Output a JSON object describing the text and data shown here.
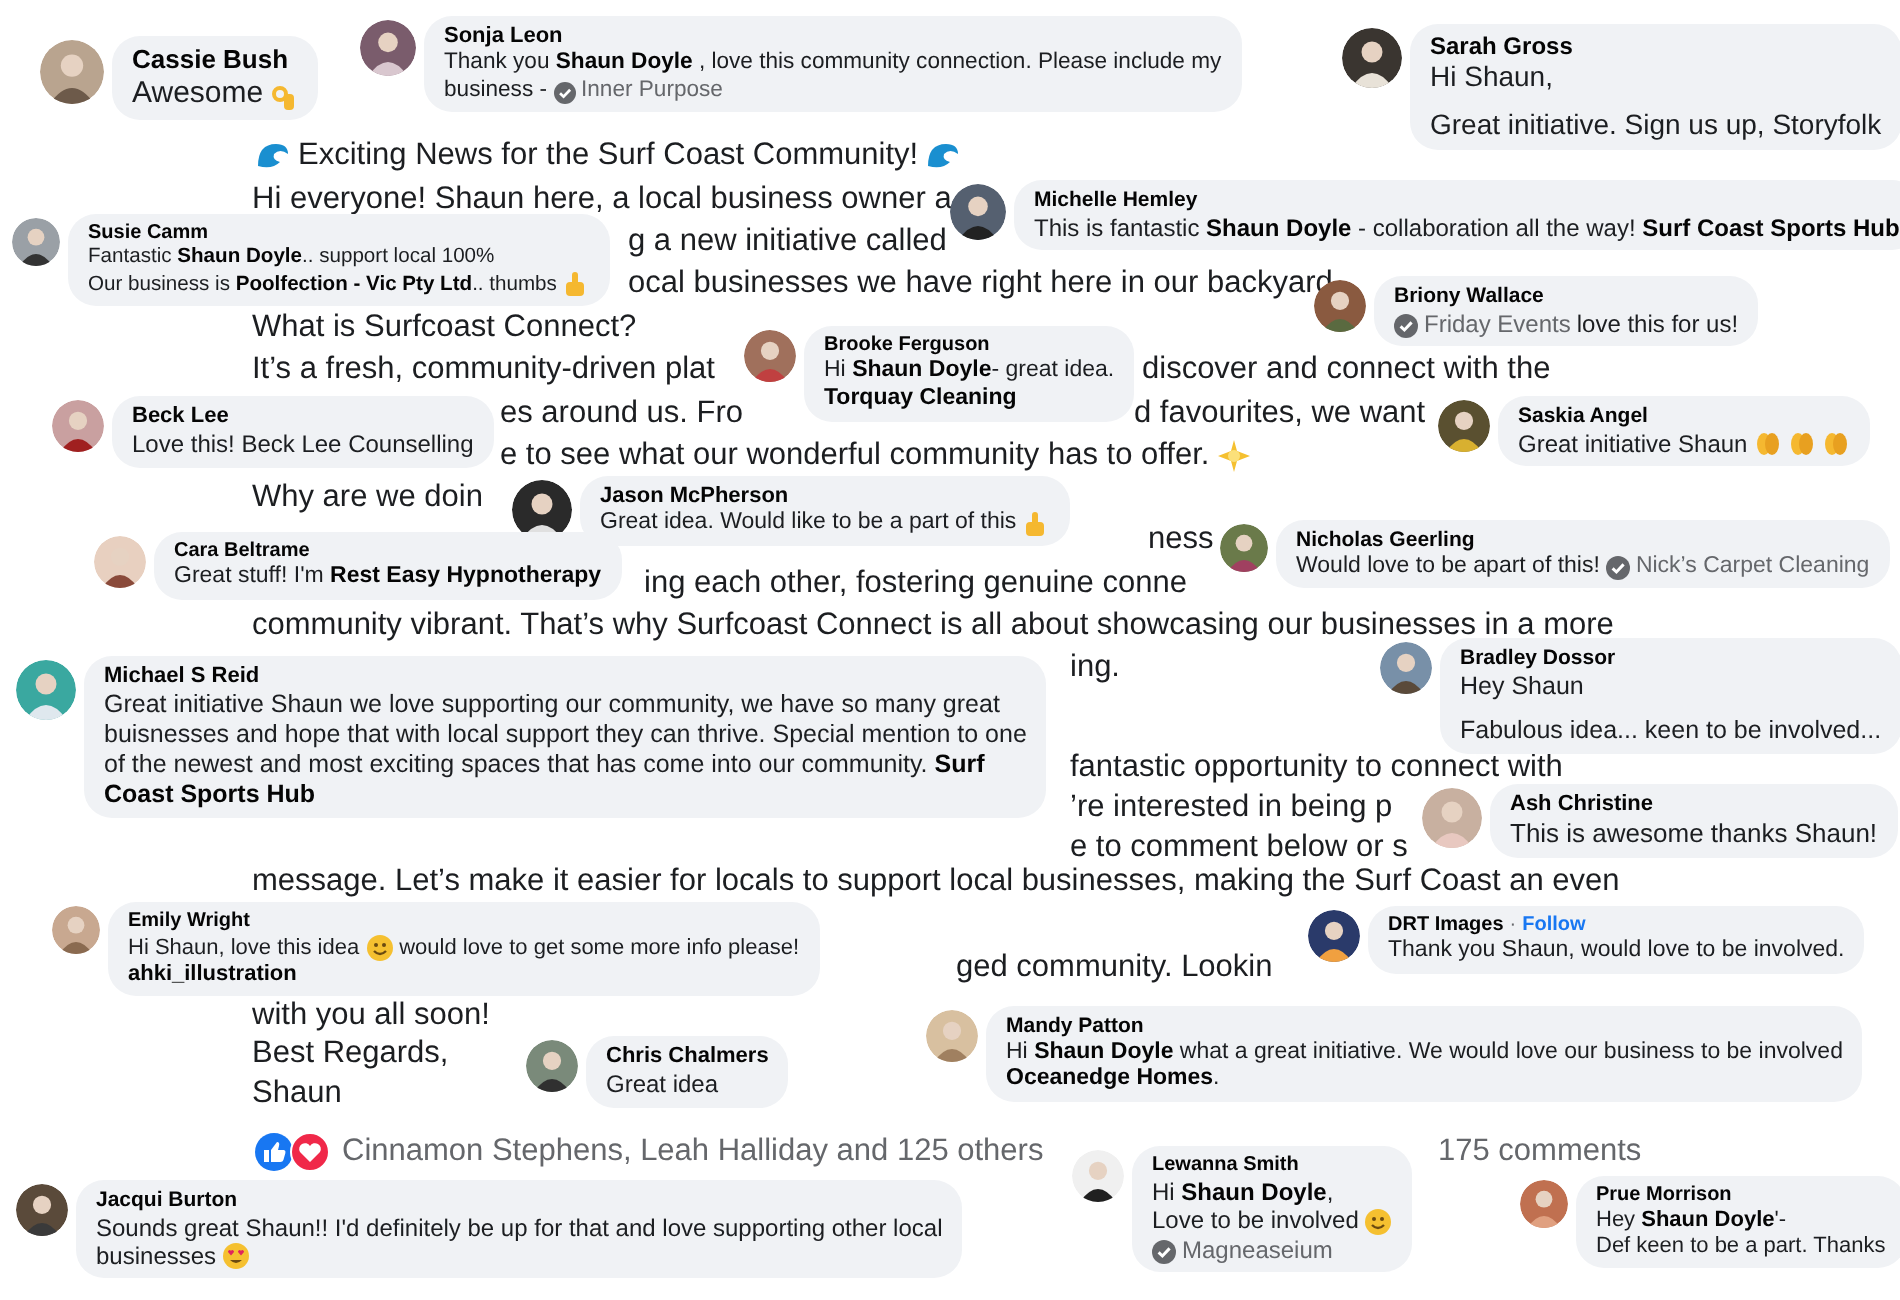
{
  "post": {
    "lines": [
      "Exciting News for the Surf Coast Community!",
      "Hi everyone! Shaun here, a local business owner a",
      "g a new initiative called",
      "ocal businesses we have right here in our backyard",
      "What is Surfcoast Connect?",
      "It’s a fresh, community-driven plat",
      "discover and connect with the",
      "es around us. Fro",
      "d favourites, we want",
      "e to see what our wonderful community has to offer.",
      "Why are we doin",
      "ness",
      "ing each other, fostering genuine conne",
      "community vibrant. That’s why Surfcoast Connect is all about showcasing our businesses in a more",
      "ing.",
      "fantastic opportunity to connect with",
      "’re interested in being p",
      "e to comment below or s",
      "message. Let’s make it easier for locals to support local businesses, making the Surf Coast an even",
      "ged community. Lookin",
      "with you all soon!",
      "Best Regards,",
      "Shaun"
    ],
    "reactions": "Cinnamon Stephens, Leah Halliday and 125 others",
    "comments_count": "175 comments"
  },
  "comments": [
    {
      "name": "Cassie Bush",
      "lines": [
        {
          "text": "Awesome"
        }
      ]
    },
    {
      "name": "Sonja Leon",
      "lines": [
        {
          "text": "Thank you **Shaun Doyle** , love this community connection. Please include my"
        },
        {
          "text": "business -",
          "page": "Inner Purpose"
        }
      ]
    },
    {
      "name": "Sarah Gross",
      "lines": [
        {
          "text": "Hi Shaun,"
        },
        {
          "text": "Great initiative. Sign us up, Storyfolk",
          "gap_before": true
        }
      ]
    },
    {
      "name": "Susie Camm",
      "lines": [
        {
          "text": "Fantastic **Shaun Doyle**.. support local 100%"
        },
        {
          "text": "Our business is **Poolfection - Vic Pty Ltd**.. thumbs"
        }
      ]
    },
    {
      "name": "Michelle Hemley",
      "lines": [
        {
          "text": "This is fantastic **Shaun Doyle** - collaboration all the way! **Surf Coast Sports Hub**"
        }
      ]
    },
    {
      "name": "Briony Wallace",
      "lines": [
        {
          "page": "Friday Events",
          "page_before": true,
          "text": "love this for us!"
        }
      ]
    },
    {
      "name": "Brooke Ferguson",
      "lines": [
        {
          "text": "Hi **Shaun Doyle**- great idea."
        },
        {
          "text": "**Torquay Cleaning**"
        }
      ]
    },
    {
      "name": "Beck Lee",
      "lines": [
        {
          "text": "Love this! Beck Lee Counselling"
        }
      ]
    },
    {
      "name": "Saskia Angel",
      "lines": [
        {
          "text": "Great initiative Shaun"
        }
      ]
    },
    {
      "name": "Jason McPherson",
      "lines": [
        {
          "text": "Great idea. Would like to be a part of this"
        }
      ]
    },
    {
      "name": "Cara Beltrame",
      "lines": [
        {
          "text": "Great stuff! I'm **Rest Easy Hypnotherapy**"
        }
      ]
    },
    {
      "name": "Nicholas Geerling",
      "lines": [
        {
          "text": "Would love to be apart of this!",
          "page": "Nick’s Carpet Cleaning"
        }
      ]
    },
    {
      "name": "Michael S Reid",
      "lines": [
        {
          "text": "Great initiative Shaun we love supporting our community, we have so many great"
        },
        {
          "text": "buisnesses and hope that with local support they can thrive. Special mention to one"
        },
        {
          "text": "of the newest and most exciting spaces that has come into our community. **Surf**"
        },
        {
          "text": "**Coast Sports Hub**"
        }
      ]
    },
    {
      "name": "Bradley Dossor",
      "lines": [
        {
          "text": "Hey Shaun"
        },
        {
          "text": "Fabulous idea... keen to be involved...",
          "gap_before": true
        }
      ]
    },
    {
      "name": "Ash Christine",
      "lines": [
        {
          "text": "This is awesome thanks Shaun!"
        }
      ]
    },
    {
      "name": "Emily Wright",
      "lines": [
        {
          "text": "Hi Shaun, love this idea",
          "after": "would love to get some more info please!"
        },
        {
          "text": "**ahki_illustration**"
        }
      ]
    },
    {
      "name": "DRT Images",
      "separator": "·",
      "follow": "Follow",
      "lines": [
        {
          "text": "Thank you Shaun, would love to be involved."
        }
      ]
    },
    {
      "name": "Chris Chalmers",
      "lines": [
        {
          "text": "Great idea"
        }
      ]
    },
    {
      "name": "Mandy Patton",
      "lines": [
        {
          "text": "Hi **Shaun Doyle** what a great initiative. We would love our business to be involved"
        },
        {
          "text": "**Oceanedge Homes**."
        }
      ]
    },
    {
      "name": "Jacqui Burton",
      "lines": [
        {
          "text": "Sounds great Shaun!! I'd definitely be up for that and love supporting other local"
        },
        {
          "text": "businesses"
        }
      ]
    },
    {
      "name": "Lewanna Smith",
      "lines": [
        {
          "text": "Hi **Shaun Doyle**,"
        },
        {
          "text": "Love to be involved"
        },
        {
          "page": "Magneaseium"
        }
      ]
    },
    {
      "name": "Prue Morrison",
      "lines": [
        {
          "text": "Hey **Shaun Doyle**'-"
        },
        {
          "text": "Def keen to be a part. Thanks"
        }
      ]
    }
  ]
}
